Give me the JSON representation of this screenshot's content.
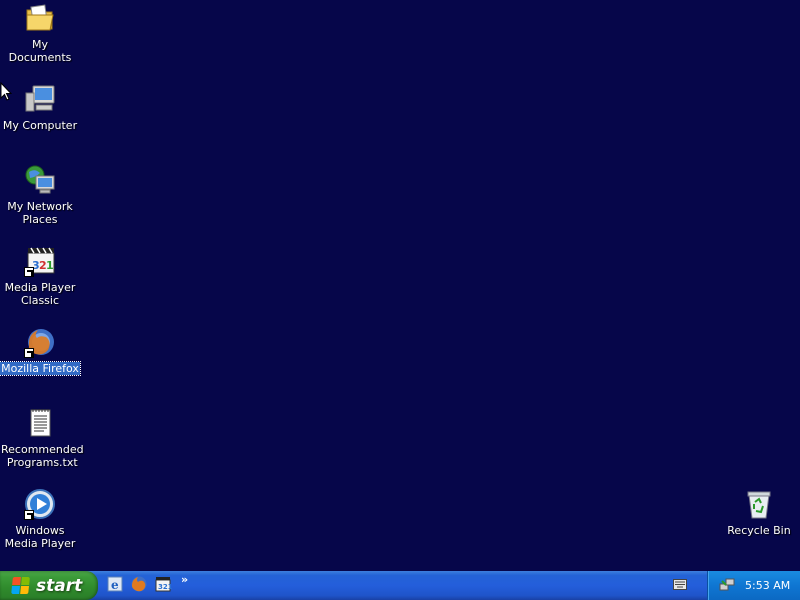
{
  "desktop": {
    "icons": [
      {
        "label": "My Documents",
        "icon": "folder-documents-icon"
      },
      {
        "label": "My Computer",
        "icon": "computer-icon"
      },
      {
        "label": "My Network Places",
        "icon": "network-icon"
      },
      {
        "label": "Media Player Classic",
        "icon": "media-player-classic-icon"
      },
      {
        "label": "Mozilla Firefox",
        "icon": "firefox-icon"
      },
      {
        "label": "Recommended Programs.txt",
        "icon": "text-file-icon"
      },
      {
        "label": "Windows Media Player",
        "icon": "windows-media-player-icon"
      },
      {
        "label": "Recycle Bin",
        "icon": "recycle-bin-icon"
      }
    ],
    "selected_icon": "Mozilla Firefox",
    "background_color": "#06064a"
  },
  "taskbar": {
    "start_label": "start",
    "quick_launch": [
      "internet-explorer-icon",
      "firefox-icon",
      "media-player-classic-icon"
    ],
    "overflow_label": "»",
    "clock": "5:53 AM",
    "accent": "#245edb",
    "start_color": "#3c9c39"
  }
}
